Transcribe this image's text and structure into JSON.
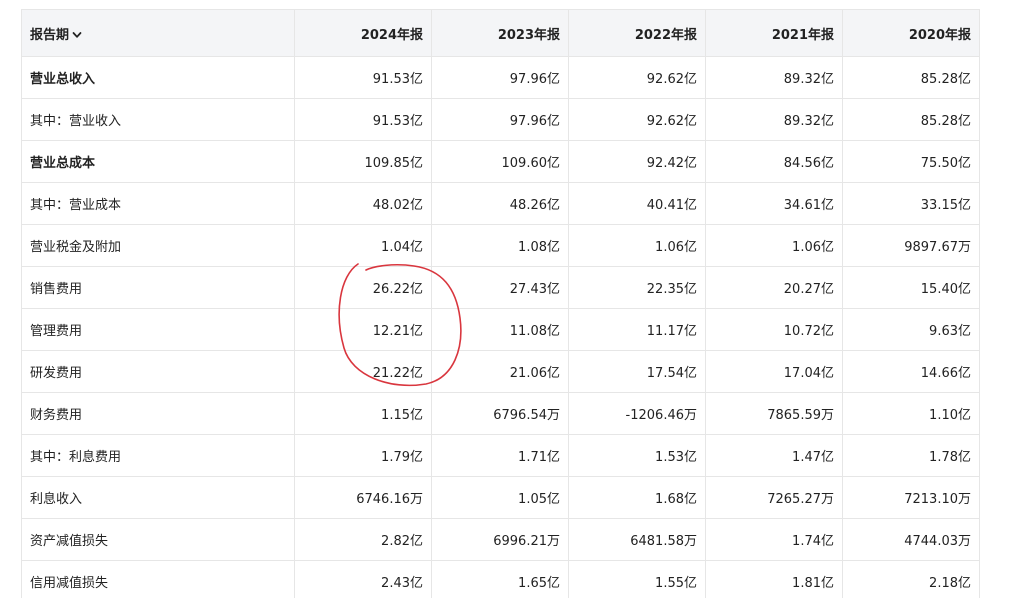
{
  "header": {
    "period_label": "报告期",
    "years": [
      "2024年报",
      "2023年报",
      "2022年报",
      "2021年报",
      "2020年报"
    ]
  },
  "rows": [
    {
      "name": "营业总收入",
      "bold": true,
      "values": [
        "91.53亿",
        "97.96亿",
        "92.62亿",
        "89.32亿",
        "85.28亿"
      ]
    },
    {
      "name": "其中：营业收入",
      "bold": false,
      "values": [
        "91.53亿",
        "97.96亿",
        "92.62亿",
        "89.32亿",
        "85.28亿"
      ]
    },
    {
      "name": "营业总成本",
      "bold": true,
      "values": [
        "109.85亿",
        "109.60亿",
        "92.42亿",
        "84.56亿",
        "75.50亿"
      ]
    },
    {
      "name": "其中：营业成本",
      "bold": false,
      "values": [
        "48.02亿",
        "48.26亿",
        "40.41亿",
        "34.61亿",
        "33.15亿"
      ]
    },
    {
      "name": "营业税金及附加",
      "bold": false,
      "values": [
        "1.04亿",
        "1.08亿",
        "1.06亿",
        "1.06亿",
        "9897.67万"
      ]
    },
    {
      "name": "销售费用",
      "bold": false,
      "values": [
        "26.22亿",
        "27.43亿",
        "22.35亿",
        "20.27亿",
        "15.40亿"
      ]
    },
    {
      "name": "管理费用",
      "bold": false,
      "values": [
        "12.21亿",
        "11.08亿",
        "11.17亿",
        "10.72亿",
        "9.63亿"
      ]
    },
    {
      "name": "研发费用",
      "bold": false,
      "values": [
        "21.22亿",
        "21.06亿",
        "17.54亿",
        "17.04亿",
        "14.66亿"
      ]
    },
    {
      "name": "财务费用",
      "bold": false,
      "values": [
        "1.15亿",
        "6796.54万",
        "-1206.46万",
        "7865.59万",
        "1.10亿"
      ]
    },
    {
      "name": "其中：利息费用",
      "bold": false,
      "values": [
        "1.79亿",
        "1.71亿",
        "1.53亿",
        "1.47亿",
        "1.78亿"
      ]
    },
    {
      "name": "利息收入",
      "bold": false,
      "values": [
        "6746.16万",
        "1.05亿",
        "1.68亿",
        "7265.27万",
        "7213.10万"
      ]
    },
    {
      "name": "资产减值损失",
      "bold": false,
      "values": [
        "2.82亿",
        "6996.21万",
        "6481.58万",
        "1.74亿",
        "4744.03万"
      ]
    },
    {
      "name": "信用减值损失",
      "bold": false,
      "values": [
        "2.43亿",
        "1.65亿",
        "1.55亿",
        "1.81亿",
        "2.18亿"
      ]
    }
  ],
  "annotation": {
    "color": "#d9363e"
  }
}
